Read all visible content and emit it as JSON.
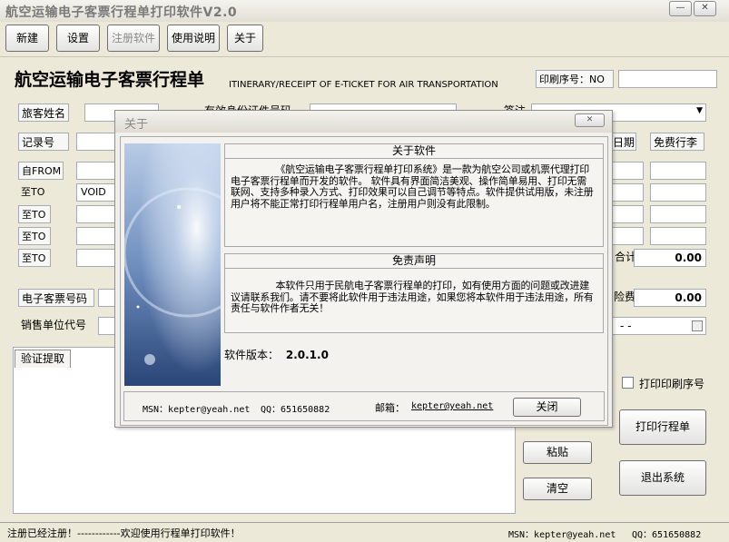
{
  "window": {
    "title": "航空运输电子客票行程单打印软件V2.0",
    "minimize": "—",
    "close": "✕"
  },
  "toolbar": {
    "new": "新建",
    "settings": "设置",
    "register": "注册软件",
    "help": "使用说明",
    "about": "关于"
  },
  "header": {
    "title": "航空运输电子客票行程单",
    "subtitle": "ITINERARY/RECEIPT OF E-TICKET FOR AIR TRANSPORTATION",
    "print_no_label": "印刷序号：NO",
    "print_no_value": ""
  },
  "form": {
    "passenger_name": "旅客姓名",
    "id_number": "有效身份证件号码",
    "endorsement": "签注",
    "record_no": "记录号",
    "date": "日期",
    "free_baggage": "免费行李",
    "from": "自FROM",
    "to1": "至TO",
    "to1_value": "VOID",
    "to2": "至TO",
    "to3": "至TO",
    "to4": "至TO",
    "total_label": "合计",
    "total_value": "0.00",
    "eticket_no": "电子客票号码",
    "fee_label": "险费",
    "fee_value": "0.00",
    "agent_code": "销售单位代号",
    "dashes": "- -"
  },
  "tabs": {
    "verify": "验证提取"
  },
  "side": {
    "paste": "粘贴",
    "clear": "清空",
    "print_seq": "打印印刷序号",
    "print_itinerary": "打印行程单",
    "exit": "退出系统"
  },
  "dialog": {
    "title": "关于",
    "close_x": "✕",
    "about_header": "关于软件",
    "about_text": "《航空运输电子客票行程单打印系统》是一款为航空公司或机票代理打印电子客票行程单而开发的软件。 软件具有界面简洁美观、操作简单易用、打印无需联网、支持多种录入方式、打印效果可以自己调节等特点。软件提供试用版，未注册用户将不能正常打印行程单用户名，注册用户则没有此限制。",
    "disclaimer_header": "免责声明",
    "disclaimer_text": "本软件只用于民航电子客票行程单的打印，如有使用方面的问题或改进建议请联系我们。请不要将此软件用于违法用途，如果您将本软件用于违法用途，所有责任与软件作者无关！",
    "version_label": "软件版本：",
    "version": "2.0.1.0",
    "msn": "MSN：kepter@yeah.net",
    "qq": "QQ：651650882",
    "email_label": "邮箱：",
    "email": "kepter@yeah.net",
    "close": "关闭"
  },
  "status": {
    "left": "注册已经注册！------------欢迎使用行程单打印软件！",
    "msn": "MSN：kepter@yeah.net",
    "qq": "QQ：651650882"
  }
}
